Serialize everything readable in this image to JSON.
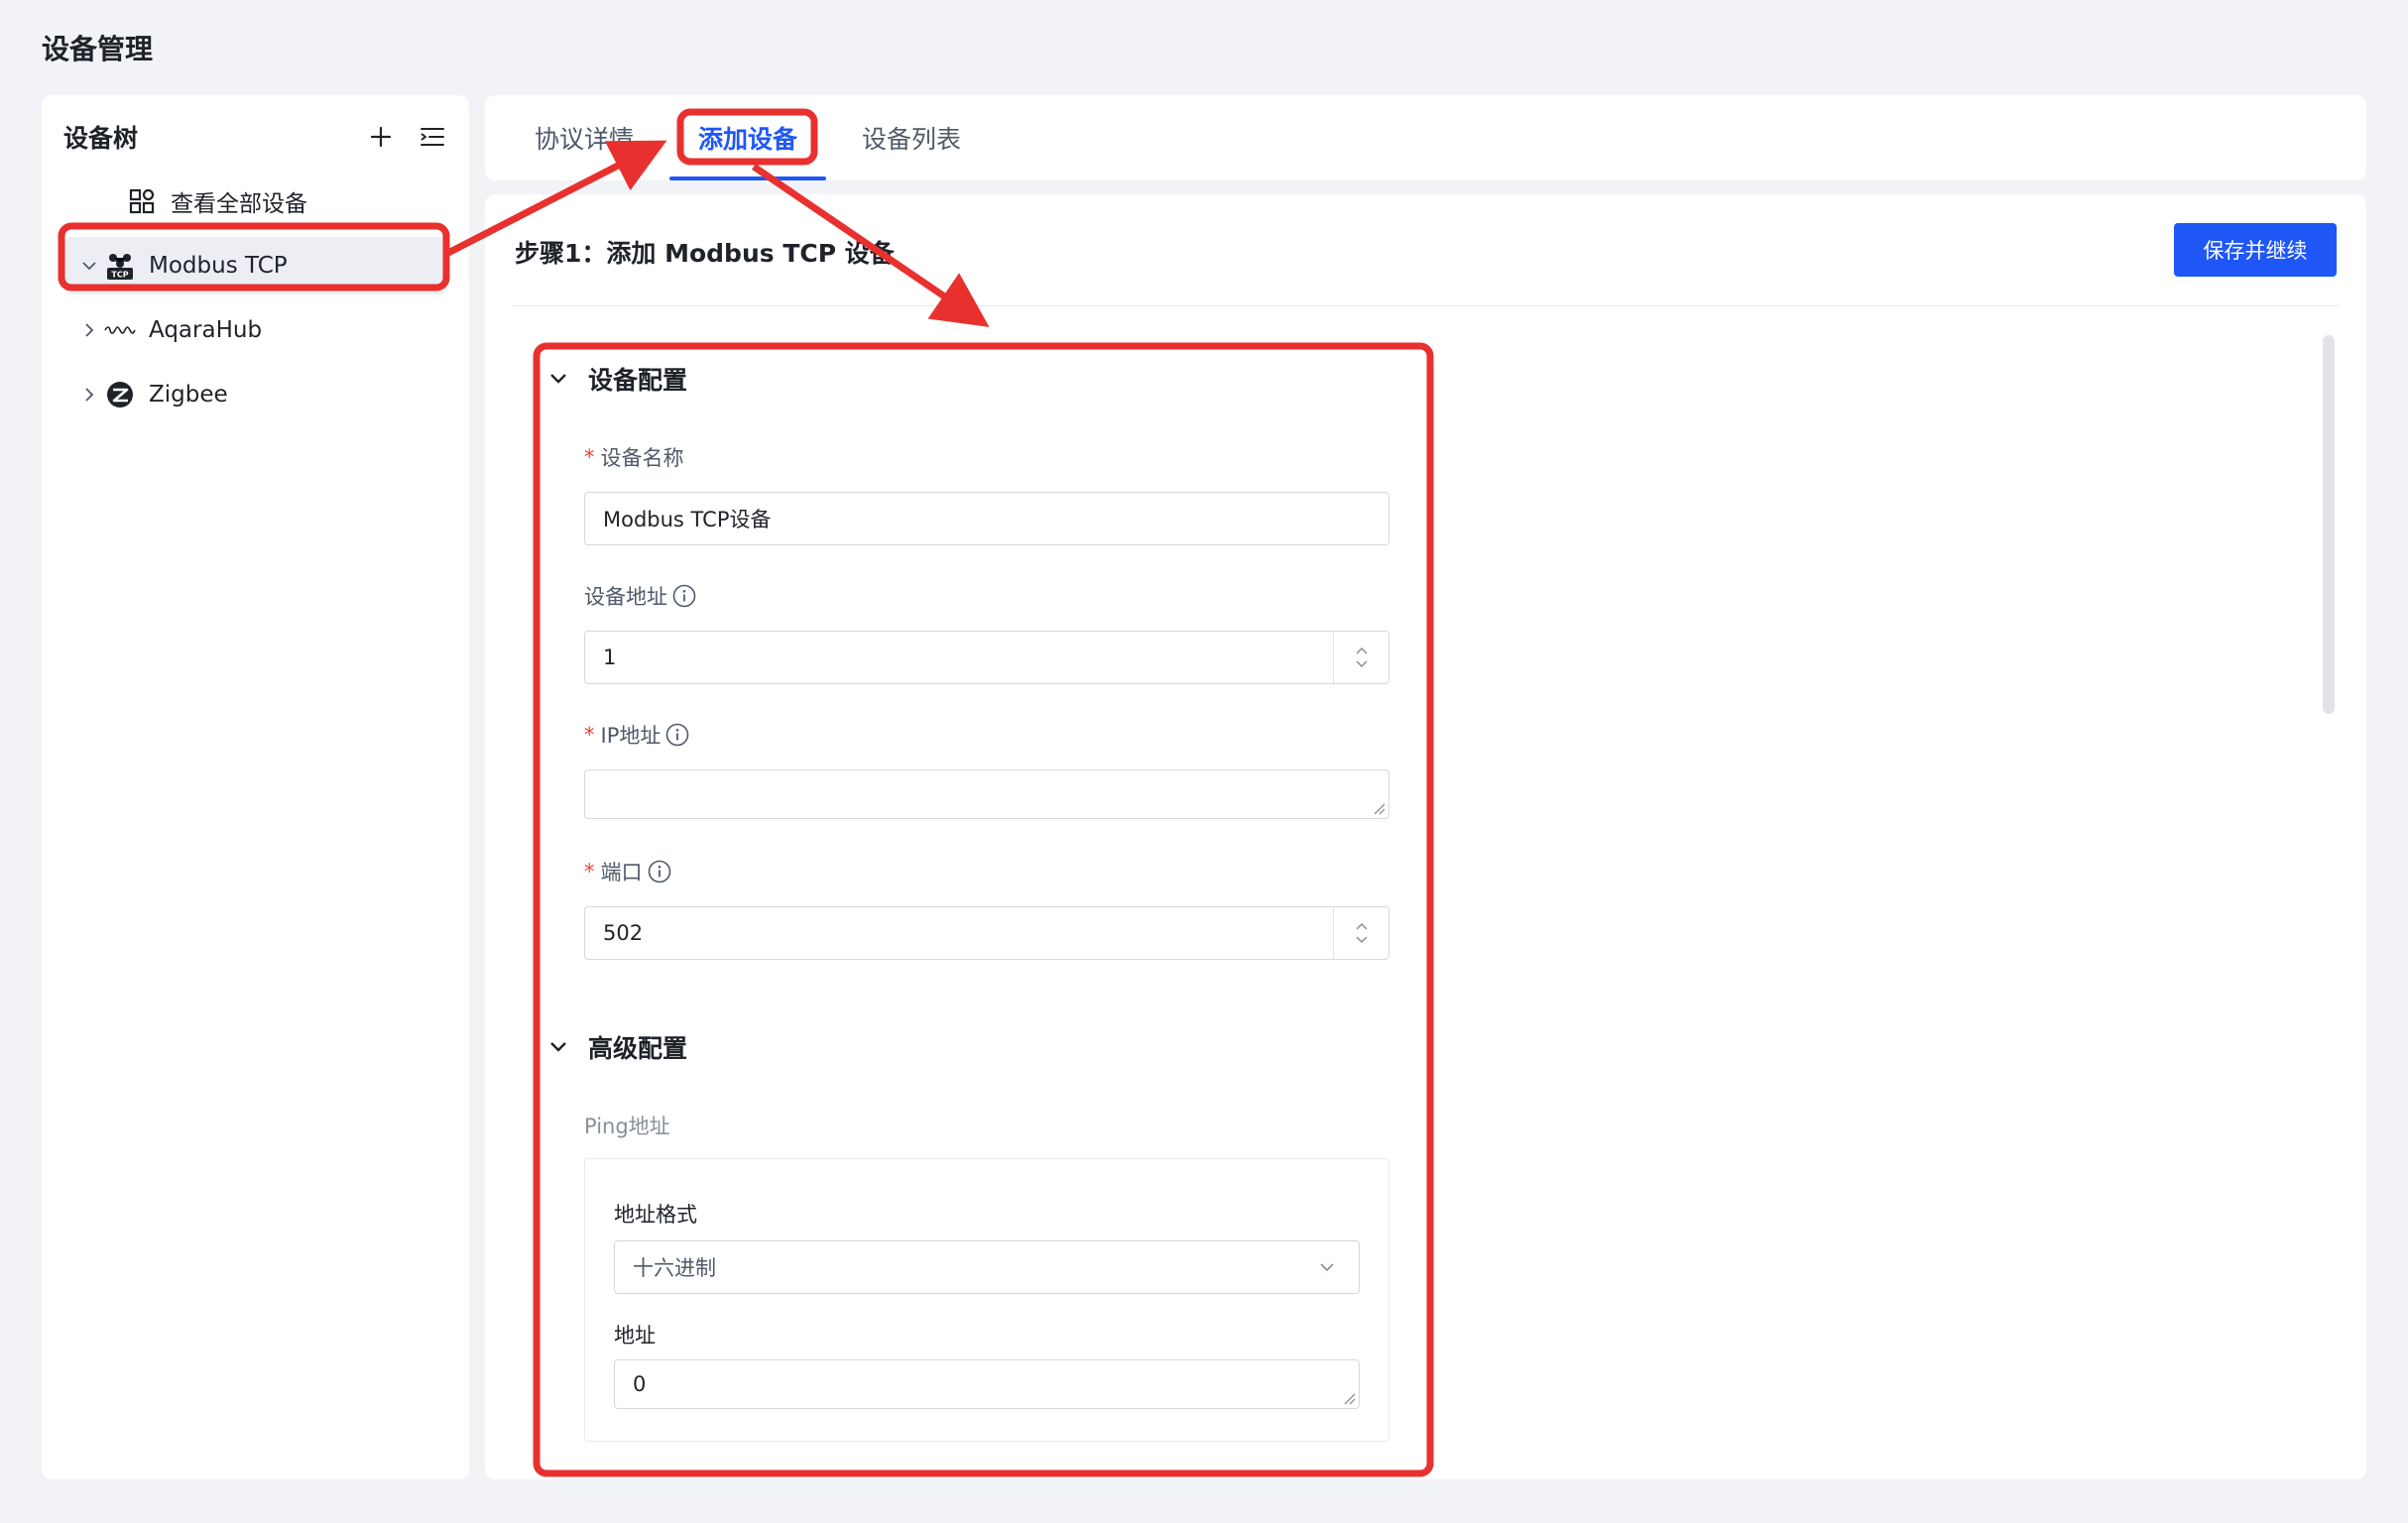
{
  "page": {
    "title": "设备管理"
  },
  "tree": {
    "title": "设备树",
    "add_icon": "plus-icon",
    "menu_icon": "list-indent-icon",
    "view_all_label": "查看全部设备",
    "items": [
      {
        "label": "Modbus TCP",
        "icon": "modbus-tcp-icon",
        "expanded": true,
        "selected": true
      },
      {
        "label": "AqaraHub",
        "icon": "aqara-wave-icon",
        "expanded": false
      },
      {
        "label": "Zigbee",
        "icon": "zigbee-icon",
        "expanded": false
      }
    ]
  },
  "tabs": [
    {
      "label": "协议详情",
      "active": false
    },
    {
      "label": "添加设备",
      "active": true
    },
    {
      "label": "设备列表",
      "active": false
    }
  ],
  "main": {
    "step_title": "步骤1：添加 Modbus TCP 设备",
    "save_button": "保存并继续",
    "sections": {
      "device_config": {
        "title": "设备配置",
        "device_name": {
          "label": "设备名称",
          "required": true,
          "value": "Modbus TCP设备"
        },
        "device_address": {
          "label": "设备地址",
          "required": false,
          "value": "1"
        },
        "ip_address": {
          "label": "IP地址",
          "required": true,
          "value": ""
        },
        "port": {
          "label": "端口",
          "required": true,
          "value": "502"
        }
      },
      "advanced_config": {
        "title": "高级配置",
        "ping_label": "Ping地址",
        "address_format": {
          "label": "地址格式",
          "value": "十六进制"
        },
        "address": {
          "label": "地址",
          "value": "0"
        }
      }
    }
  },
  "colors": {
    "accent": "#1f56f6",
    "annotation": "#e8312f",
    "required": "#f53f3f",
    "background": "#f2f3f7"
  }
}
